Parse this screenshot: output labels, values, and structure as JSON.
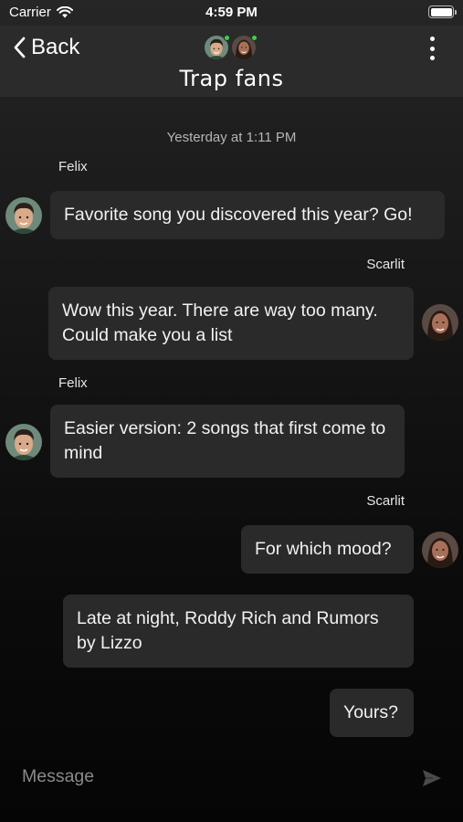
{
  "status_bar": {
    "carrier": "Carrier",
    "time": "4:59 PM"
  },
  "nav": {
    "back_label": "Back",
    "title": "Trap fans"
  },
  "conversation": {
    "timestamp": "Yesterday at 1:11 PM",
    "messages": [
      {
        "sender": "Felix",
        "text": "Favorite song you discovered this year? Go!"
      },
      {
        "sender": "Scarlit",
        "text": "Wow this year. There are way too many. Could make you a list"
      },
      {
        "sender": "Felix",
        "text": "Easier version: 2 songs that first come to mind"
      },
      {
        "sender": "Scarlit",
        "text": "For which mood?"
      },
      {
        "sender": "",
        "text": "Late at night, Roddy Rich and Rumors by Lizzo"
      },
      {
        "sender": "",
        "text": "Yours?"
      }
    ]
  },
  "composer": {
    "placeholder": "Message"
  },
  "colors": {
    "bubble": "#2a2a2a",
    "nav_background": "#2b2b2b",
    "online": "#3ecf4d"
  }
}
